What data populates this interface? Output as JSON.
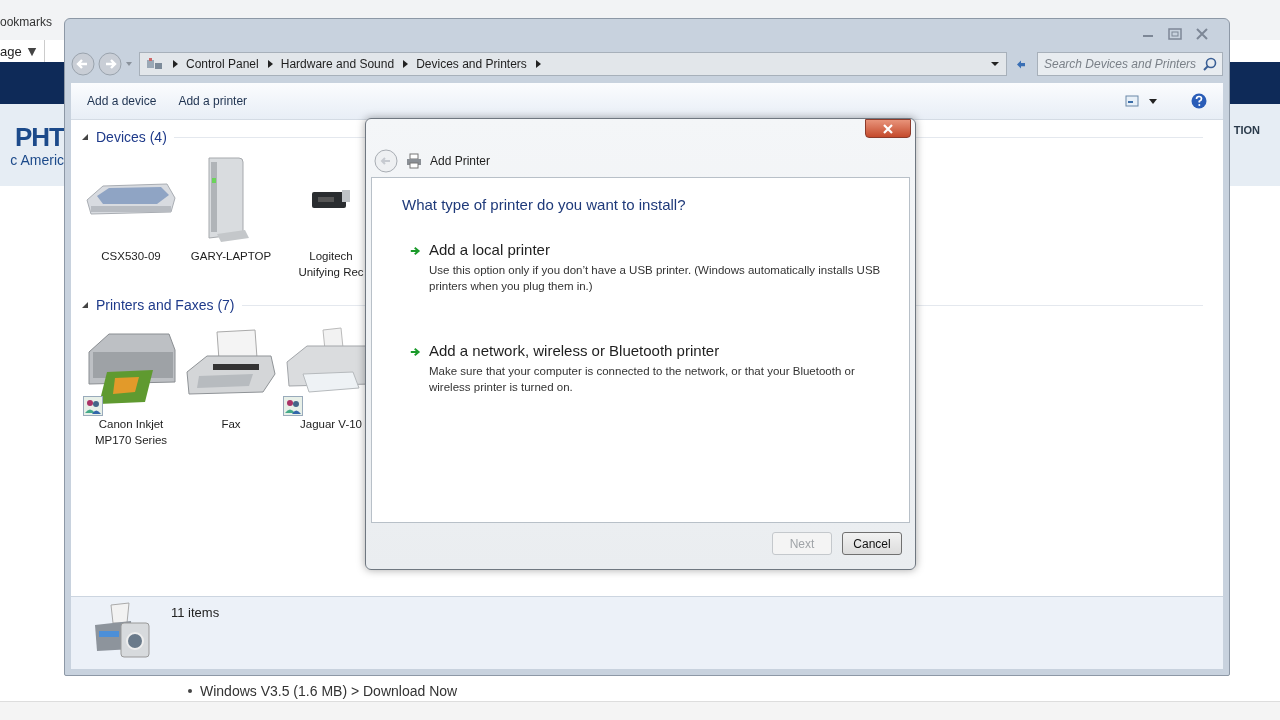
{
  "browser": {
    "bookmarks_label": "ookmarks",
    "page_menu": "age",
    "page_menu_caret": "▼",
    "logo_top": "PHT",
    "logo_bottom": "c Americ",
    "nav_right": "TION",
    "download_line": "Windows V3.5 (1.6 MB) > Download Now"
  },
  "window": {
    "breadcrumb": [
      "Control Panel",
      "Hardware and Sound",
      "Devices and Printers"
    ],
    "search": {
      "placeholder": "Search Devices and Printers"
    },
    "toolbar": [
      "Add a device",
      "Add a printer"
    ],
    "sections": [
      {
        "title": "Devices (4)",
        "expanded": true,
        "items": [
          {
            "kind": "scanner",
            "lines": [
              "CSX530-09"
            ],
            "shared": false
          },
          {
            "kind": "tower",
            "lines": [
              "GARY-LAPTOP"
            ],
            "shared": false
          },
          {
            "kind": "receiver",
            "lines": [
              "Logitech",
              "Unifying Rec"
            ],
            "shared": false
          }
        ]
      },
      {
        "title": "Printers and Faxes (7)",
        "expanded": true,
        "items": [
          {
            "kind": "photo-printer",
            "lines": [
              "Canon Inkjet",
              "MP170 Series"
            ],
            "shared": true
          },
          {
            "kind": "fax",
            "lines": [
              "Fax"
            ],
            "shared": false
          },
          {
            "kind": "printer",
            "lines": [
              "Jaguar V-10"
            ],
            "shared": true
          }
        ]
      }
    ],
    "status": {
      "count": "11 items"
    }
  },
  "dialog": {
    "title": "Add Printer",
    "question": "What type of printer do you want to install?",
    "options": [
      {
        "title": "Add a local printer",
        "description": "Use this option only if you don’t have a USB printer. (Windows automatically installs USB printers when you plug them in.)"
      },
      {
        "title": "Add a network, wireless or Bluetooth printer",
        "description": "Make sure that your computer is connected to the network, or that your Bluetooth or wireless printer is turned on."
      }
    ],
    "buttons": [
      {
        "label": "Next",
        "disabled": true
      },
      {
        "label": "Cancel",
        "disabled": false
      }
    ]
  }
}
